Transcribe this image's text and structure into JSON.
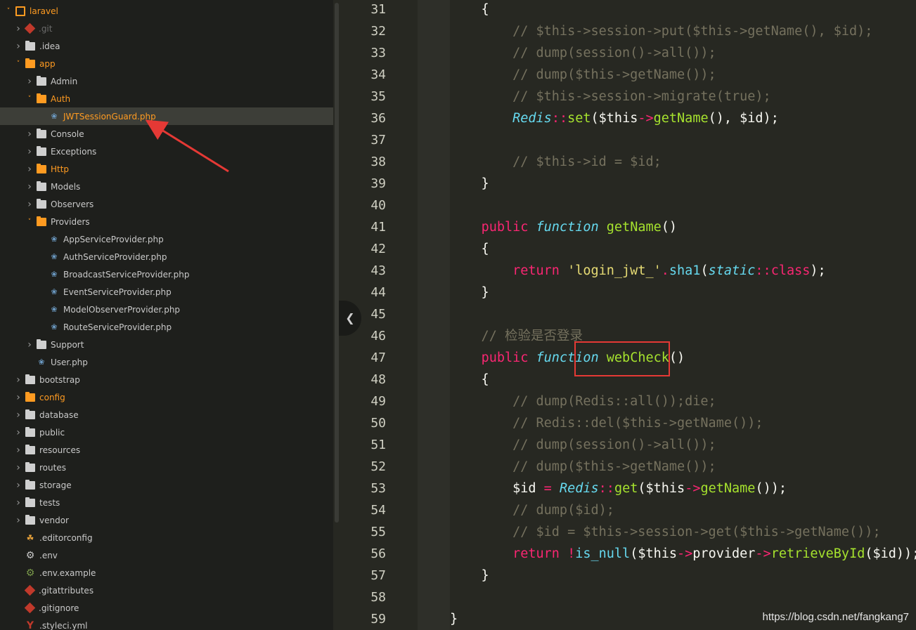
{
  "sidebar": {
    "items": [
      {
        "label": "laravel",
        "icon": "repo-icon",
        "chev": "down",
        "style": "orange",
        "depth": 0
      },
      {
        "label": ".git",
        "icon": "git-icon",
        "chev": "right",
        "style": "dim",
        "depth": 1
      },
      {
        "label": ".idea",
        "icon": "folder-icon",
        "chev": "right",
        "style": "normal",
        "depth": 1
      },
      {
        "label": "app",
        "icon": "folder-open-icon",
        "chev": "down",
        "style": "orange",
        "depth": 1
      },
      {
        "label": "Admin",
        "icon": "folder-icon",
        "chev": "right",
        "style": "normal",
        "depth": 2
      },
      {
        "label": "Auth",
        "icon": "folder-open-icon",
        "chev": "down",
        "style": "orange",
        "depth": 2
      },
      {
        "label": "JWTSessionGuard.php",
        "icon": "php-icon",
        "chev": "",
        "style": "selected",
        "depth": 3
      },
      {
        "label": "Console",
        "icon": "folder-icon",
        "chev": "right",
        "style": "normal",
        "depth": 2
      },
      {
        "label": "Exceptions",
        "icon": "folder-icon",
        "chev": "right",
        "style": "normal",
        "depth": 2
      },
      {
        "label": "Http",
        "icon": "folder-orange-icon",
        "chev": "right",
        "style": "orange",
        "depth": 2
      },
      {
        "label": "Models",
        "icon": "folder-icon",
        "chev": "right",
        "style": "normal",
        "depth": 2
      },
      {
        "label": "Observers",
        "icon": "folder-icon",
        "chev": "right",
        "style": "normal",
        "depth": 2
      },
      {
        "label": "Providers",
        "icon": "folder-open-icon",
        "chev": "down",
        "style": "normal",
        "depth": 2
      },
      {
        "label": "AppServiceProvider.php",
        "icon": "php-icon",
        "chev": "",
        "style": "normal",
        "depth": 3
      },
      {
        "label": "AuthServiceProvider.php",
        "icon": "php-icon",
        "chev": "",
        "style": "normal",
        "depth": 3
      },
      {
        "label": "BroadcastServiceProvider.php",
        "icon": "php-icon",
        "chev": "",
        "style": "normal",
        "depth": 3
      },
      {
        "label": "EventServiceProvider.php",
        "icon": "php-icon",
        "chev": "",
        "style": "normal",
        "depth": 3
      },
      {
        "label": "ModelObserverProvider.php",
        "icon": "php-icon",
        "chev": "",
        "style": "normal",
        "depth": 3
      },
      {
        "label": "RouteServiceProvider.php",
        "icon": "php-icon",
        "chev": "",
        "style": "normal",
        "depth": 3
      },
      {
        "label": "Support",
        "icon": "folder-icon",
        "chev": "right",
        "style": "normal",
        "depth": 2
      },
      {
        "label": "User.php",
        "icon": "php-icon",
        "chev": "",
        "style": "normal",
        "depth": 2
      },
      {
        "label": "bootstrap",
        "icon": "folder-icon",
        "chev": "right",
        "style": "normal",
        "depth": 1
      },
      {
        "label": "config",
        "icon": "folder-orange-icon",
        "chev": "right",
        "style": "orange",
        "depth": 1
      },
      {
        "label": "database",
        "icon": "folder-icon",
        "chev": "right",
        "style": "normal",
        "depth": 1
      },
      {
        "label": "public",
        "icon": "folder-icon",
        "chev": "right",
        "style": "normal",
        "depth": 1
      },
      {
        "label": "resources",
        "icon": "folder-icon",
        "chev": "right",
        "style": "normal",
        "depth": 1
      },
      {
        "label": "routes",
        "icon": "folder-icon",
        "chev": "right",
        "style": "normal",
        "depth": 1
      },
      {
        "label": "storage",
        "icon": "folder-icon",
        "chev": "right",
        "style": "normal",
        "depth": 1
      },
      {
        "label": "tests",
        "icon": "folder-icon",
        "chev": "right",
        "style": "normal",
        "depth": 1
      },
      {
        "label": "vendor",
        "icon": "folder-icon",
        "chev": "right",
        "style": "normal",
        "depth": 1
      },
      {
        "label": ".editorconfig",
        "icon": "editorconfig-icon",
        "chev": "",
        "style": "normal",
        "depth": 1
      },
      {
        "label": ".env",
        "icon": "gear-icon",
        "chev": "",
        "style": "normal",
        "depth": 1
      },
      {
        "label": ".env.example",
        "icon": "gear-green-icon",
        "chev": "",
        "style": "normal",
        "depth": 1
      },
      {
        "label": ".gitattributes",
        "icon": "git-icon",
        "chev": "",
        "style": "normal",
        "depth": 1
      },
      {
        "label": ".gitignore",
        "icon": "git-icon",
        "chev": "",
        "style": "normal",
        "depth": 1
      },
      {
        "label": ".styleci.yml",
        "icon": "yml-icon",
        "chev": "",
        "style": "normal",
        "depth": 1
      }
    ]
  },
  "editor": {
    "lines": [
      {
        "n": "31",
        "tokens": [
          {
            "t": "    {",
            "c": ""
          }
        ]
      },
      {
        "n": "32",
        "tokens": [
          {
            "t": "        // $this->session->put($this->getName(), $id);",
            "c": "cm"
          }
        ]
      },
      {
        "n": "33",
        "tokens": [
          {
            "t": "        // dump(session()->all());",
            "c": "cm"
          }
        ]
      },
      {
        "n": "34",
        "tokens": [
          {
            "t": "        // dump($this->getName());",
            "c": "cm"
          }
        ]
      },
      {
        "n": "35",
        "tokens": [
          {
            "t": "        // $this->session->migrate(true);",
            "c": "cm"
          }
        ]
      },
      {
        "n": "36",
        "tokens": [
          {
            "t": "        ",
            "c": ""
          },
          {
            "t": "Redis",
            "c": "fn"
          },
          {
            "t": "::",
            "c": "op"
          },
          {
            "t": "set",
            "c": "nm"
          },
          {
            "t": "($this",
            "c": ""
          },
          {
            "t": "->",
            "c": "op"
          },
          {
            "t": "getName",
            "c": "nm"
          },
          {
            "t": "(), $id);",
            "c": ""
          }
        ]
      },
      {
        "n": "37",
        "tokens": []
      },
      {
        "n": "38",
        "tokens": [
          {
            "t": "        // $this->id = $id;",
            "c": "cm"
          }
        ]
      },
      {
        "n": "39",
        "tokens": [
          {
            "t": "    }",
            "c": ""
          }
        ]
      },
      {
        "n": "40",
        "tokens": []
      },
      {
        "n": "41",
        "tokens": [
          {
            "t": "    ",
            "c": ""
          },
          {
            "t": "public",
            "c": "kw"
          },
          {
            "t": " ",
            "c": ""
          },
          {
            "t": "function",
            "c": "fn"
          },
          {
            "t": " ",
            "c": ""
          },
          {
            "t": "getName",
            "c": "nm"
          },
          {
            "t": "()",
            "c": ""
          }
        ]
      },
      {
        "n": "42",
        "tokens": [
          {
            "t": "    {",
            "c": ""
          }
        ]
      },
      {
        "n": "43",
        "tokens": [
          {
            "t": "        ",
            "c": ""
          },
          {
            "t": "return",
            "c": "kw"
          },
          {
            "t": " ",
            "c": ""
          },
          {
            "t": "'login_jwt_'",
            "c": "st"
          },
          {
            "t": ".",
            "c": "op"
          },
          {
            "t": "sha1",
            "c": "fn2"
          },
          {
            "t": "(",
            "c": ""
          },
          {
            "t": "static",
            "c": "fn"
          },
          {
            "t": "::",
            "c": "op"
          },
          {
            "t": "class",
            "c": "kw"
          },
          {
            "t": ");",
            "c": ""
          }
        ]
      },
      {
        "n": "44",
        "tokens": [
          {
            "t": "    }",
            "c": ""
          }
        ]
      },
      {
        "n": "45",
        "tokens": []
      },
      {
        "n": "46",
        "tokens": [
          {
            "t": "    // 检验是否登录",
            "c": "cm"
          }
        ]
      },
      {
        "n": "47",
        "tokens": [
          {
            "t": "    ",
            "c": ""
          },
          {
            "t": "public",
            "c": "kw"
          },
          {
            "t": " ",
            "c": ""
          },
          {
            "t": "function",
            "c": "fn"
          },
          {
            "t": " ",
            "c": ""
          },
          {
            "t": "webCheck",
            "c": "nm"
          },
          {
            "t": "()",
            "c": ""
          }
        ]
      },
      {
        "n": "48",
        "tokens": [
          {
            "t": "    {",
            "c": ""
          }
        ]
      },
      {
        "n": "49",
        "tokens": [
          {
            "t": "        // dump(Redis::all());die;",
            "c": "cm"
          }
        ]
      },
      {
        "n": "50",
        "tokens": [
          {
            "t": "        // Redis::del($this->getName());",
            "c": "cm"
          }
        ]
      },
      {
        "n": "51",
        "tokens": [
          {
            "t": "        // dump(session()->all());",
            "c": "cm"
          }
        ]
      },
      {
        "n": "52",
        "tokens": [
          {
            "t": "        // dump($this->getName());",
            "c": "cm"
          }
        ]
      },
      {
        "n": "53",
        "tokens": [
          {
            "t": "        ",
            "c": ""
          },
          {
            "t": "$id",
            "c": ""
          },
          {
            "t": " = ",
            "c": "op"
          },
          {
            "t": "Redis",
            "c": "fn"
          },
          {
            "t": "::",
            "c": "op"
          },
          {
            "t": "get",
            "c": "nm"
          },
          {
            "t": "($this",
            "c": ""
          },
          {
            "t": "->",
            "c": "op"
          },
          {
            "t": "getName",
            "c": "nm"
          },
          {
            "t": "());",
            "c": ""
          }
        ]
      },
      {
        "n": "54",
        "tokens": [
          {
            "t": "        // dump($id);",
            "c": "cm"
          }
        ]
      },
      {
        "n": "55",
        "tokens": [
          {
            "t": "        // $id = $this->session->get($this->getName());",
            "c": "cm"
          }
        ]
      },
      {
        "n": "56",
        "tokens": [
          {
            "t": "        ",
            "c": ""
          },
          {
            "t": "return",
            "c": "kw"
          },
          {
            "t": " ",
            "c": ""
          },
          {
            "t": "!",
            "c": "op"
          },
          {
            "t": "is_null",
            "c": "fn2"
          },
          {
            "t": "($this",
            "c": ""
          },
          {
            "t": "->",
            "c": "op"
          },
          {
            "t": "provider",
            "c": ""
          },
          {
            "t": "->",
            "c": "op"
          },
          {
            "t": "retrieveById",
            "c": "nm"
          },
          {
            "t": "($id));",
            "c": ""
          }
        ]
      },
      {
        "n": "57",
        "tokens": [
          {
            "t": "    }",
            "c": ""
          }
        ]
      },
      {
        "n": "58",
        "tokens": []
      },
      {
        "n": "59",
        "tokens": [
          {
            "t": "}",
            "c": ""
          }
        ]
      }
    ]
  },
  "collapse_icon": "chevron-left-icon",
  "watermark": "https://blog.csdn.net/fangkang7",
  "colors": {
    "accent": "#ff9b21",
    "highlight_box": "#e53935",
    "arrow": "#e53935"
  }
}
